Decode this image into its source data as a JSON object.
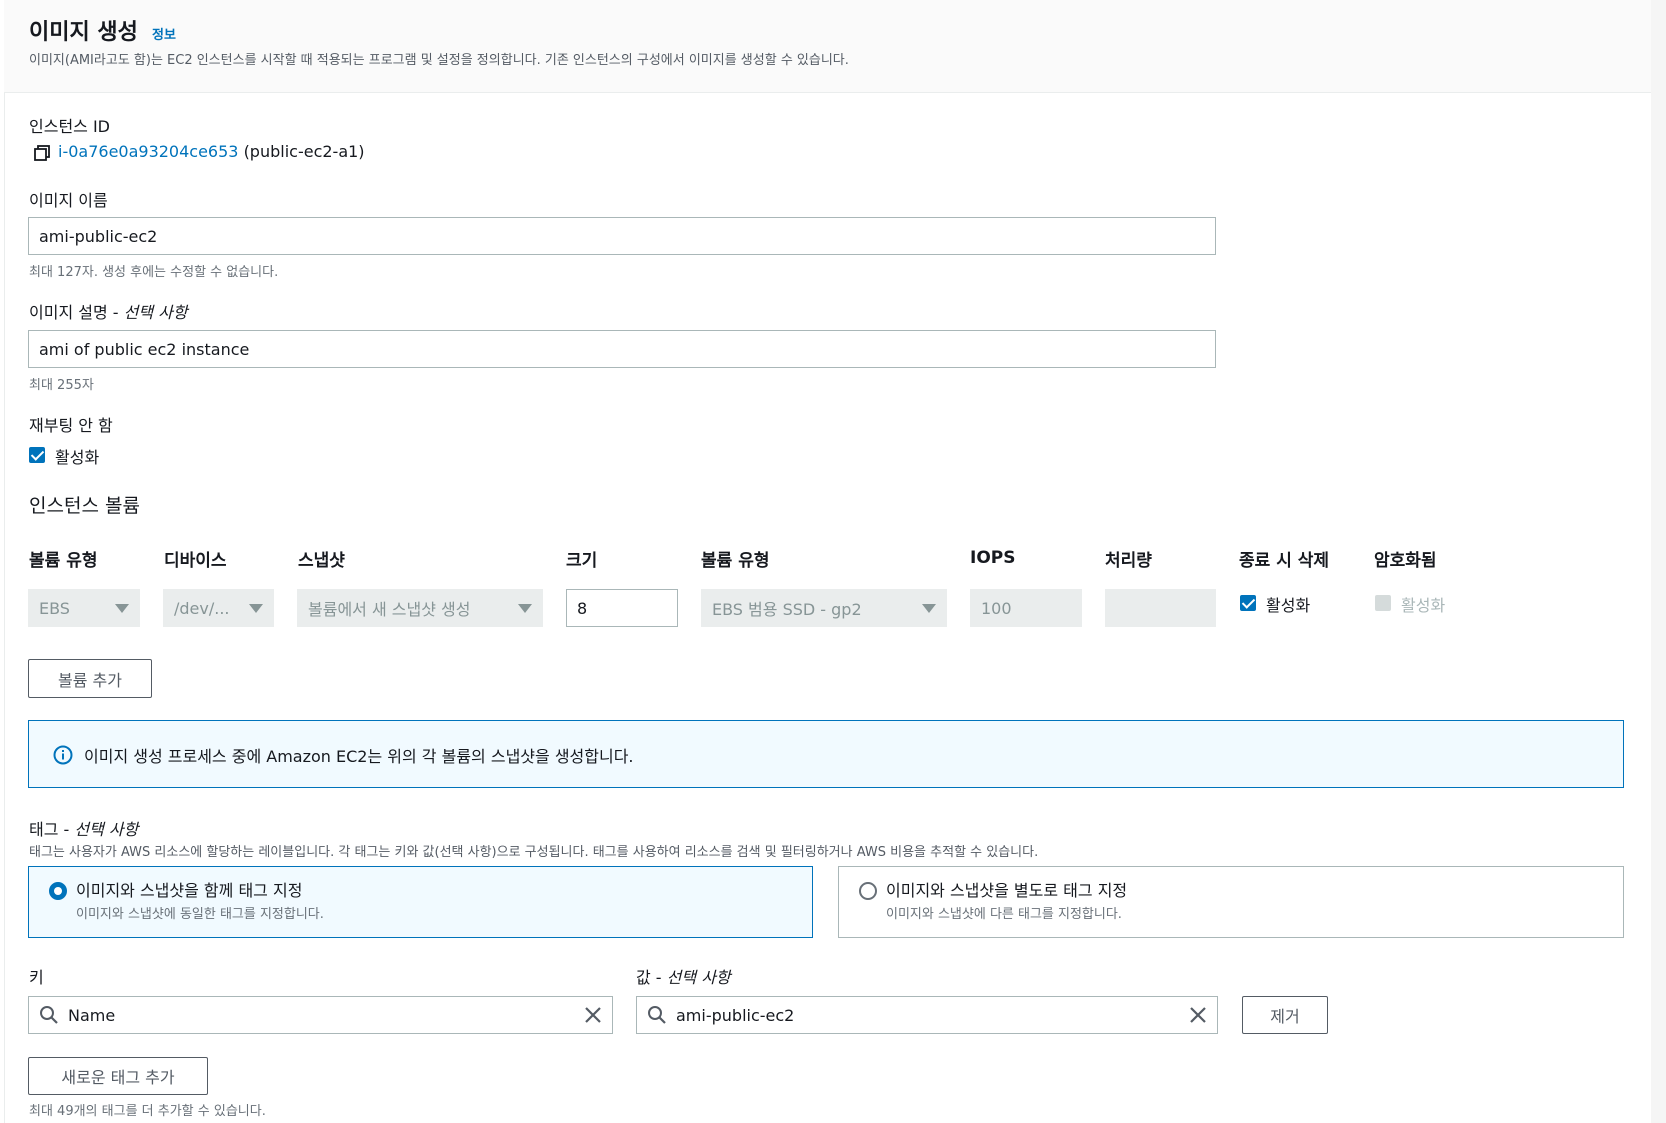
{
  "header": {
    "title": "이미지 생성",
    "info_link": "정보",
    "description": "이미지(AMI라고도 함)는 EC2 인스턴스를 시작할 때 적용되는 프로그램 및 설정을 정의합니다. 기존 인스턴스의 구성에서 이미지를 생성할 수 있습니다."
  },
  "instance": {
    "label": "인스턴스 ID",
    "id": "i-0a76e0a93204ce653",
    "name": "(public-ec2-a1)"
  },
  "image_name": {
    "label": "이미지 이름",
    "value": "ami-public-ec2",
    "hint": "최대 127자. 생성 후에는 수정할 수 없습니다."
  },
  "image_description": {
    "label": "이미지 설명 - ",
    "optional": "선택 사항",
    "value": "ami of public ec2 instance",
    "hint": "최대 255자"
  },
  "no_reboot": {
    "label": "재부팅 안 함",
    "checkbox_label": "활성화",
    "checked": true
  },
  "volumes": {
    "section_title": "인스턴스 볼륨",
    "columns": [
      "볼륨 유형",
      "디바이스",
      "스냅샷",
      "크기",
      "볼륨 유형",
      "IOPS",
      "처리량",
      "종료 시 삭제",
      "암호화됨"
    ],
    "row": {
      "storage_type": "EBS",
      "device": "/dev/...",
      "snapshot": "볼륨에서 새 스냅샷 생성",
      "size": "8",
      "volume_type": "EBS 범용 SSD - gp2",
      "iops": "100",
      "throughput": "",
      "delete_on_termination": "활성화",
      "encrypted": "활성화"
    },
    "add_button": "볼륨 추가"
  },
  "alert": {
    "text": "이미지 생성 프로세스 중에 Amazon EC2는 위의 각 볼륨의 스냅샷을 생성합니다."
  },
  "tags": {
    "label": "태그 - ",
    "optional": "선택 사항",
    "description": "태그는 사용자가 AWS 리소스에 할당하는 레이블입니다. 각 태그는 키와 값(선택 사항)으로 구성됩니다. 태그를 사용하여 리소스를 검색 및 필터링하거나 AWS 비용을 추적할 수 있습니다.",
    "options": [
      {
        "title": "이미지와 스냅샷을 함께 태그 지정",
        "desc": "이미지와 스냅샷에 동일한 태그를 지정합니다.",
        "selected": true
      },
      {
        "title": "이미지와 스냅샷을 별도로 태그 지정",
        "desc": "이미지와 스냅샷에 다른 태그를 지정합니다.",
        "selected": false
      }
    ],
    "key_label": "키",
    "value_label": "값 - ",
    "value_optional": "선택 사항",
    "key_value": "Name",
    "value_value": "ami-public-ec2",
    "remove_button": "제거",
    "add_button": "새로운 태그 추가",
    "hint": "최대 49개의 태그를 더 추가할 수 있습니다."
  },
  "colors": {
    "link": "#0073bb",
    "text": "#16191f",
    "muted": "#687078",
    "border": "#aab7b8",
    "disabled_bg": "#eaeded",
    "alert_bg": "#f1faff"
  }
}
